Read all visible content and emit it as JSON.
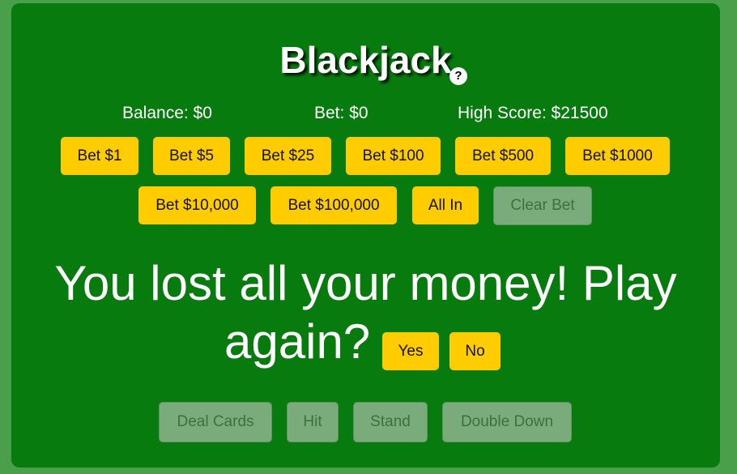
{
  "game": {
    "title": "Blackjack",
    "help_symbol": "?"
  },
  "stats": {
    "balance": "Balance: $0",
    "bet": "Bet: $0",
    "high_score": "High Score: $21500"
  },
  "bet_buttons": {
    "bet_1": "Bet $1",
    "bet_5": "Bet $5",
    "bet_25": "Bet $25",
    "bet_100": "Bet $100",
    "bet_500": "Bet $500",
    "bet_1000": "Bet $1000",
    "bet_10000": "Bet $10,000",
    "bet_100000": "Bet $100,000",
    "all_in": "All In",
    "clear_bet": "Clear Bet"
  },
  "game_over": {
    "message_line1": "You lost all your money! Play",
    "message_line2": "again?",
    "yes": "Yes",
    "no": "No"
  },
  "actions": {
    "deal": "Deal Cards",
    "hit": "Hit",
    "stand": "Stand",
    "double_down": "Double Down"
  },
  "colors": {
    "page_background": "#4a9f4a",
    "table_felt": "#087b0f",
    "button_active": "#ffcc00",
    "button_disabled": "#7aab7a",
    "text": "#ffffff"
  }
}
